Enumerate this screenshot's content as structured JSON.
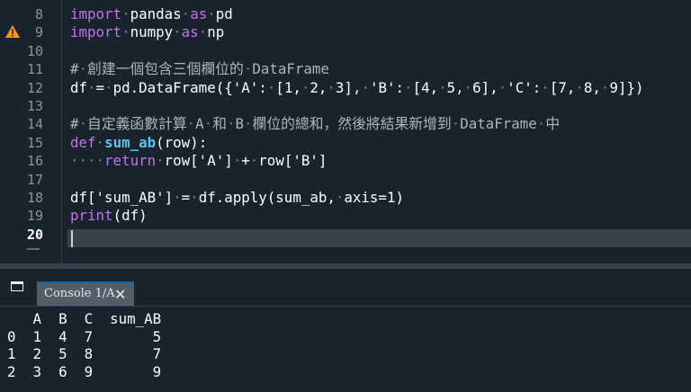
{
  "editor": {
    "line_numbers": [
      "8",
      "9",
      "10",
      "11",
      "12",
      "13",
      "14",
      "15",
      "16",
      "17",
      "18",
      "19",
      "20"
    ],
    "current_line": "20",
    "lines": [
      [
        {
          "c": "kw",
          "t": "import"
        },
        {
          "c": "dt",
          "t": "·"
        },
        {
          "c": "",
          "t": "pandas"
        },
        {
          "c": "dt",
          "t": "·"
        },
        {
          "c": "kw",
          "t": "as"
        },
        {
          "c": "dt",
          "t": "·"
        },
        {
          "c": "",
          "t": "pd"
        }
      ],
      [
        {
          "c": "kw",
          "t": "import"
        },
        {
          "c": "dt",
          "t": "·"
        },
        {
          "c": "",
          "t": "numpy"
        },
        {
          "c": "dt",
          "t": "·"
        },
        {
          "c": "kw",
          "t": "as"
        },
        {
          "c": "dt",
          "t": "·"
        },
        {
          "c": "",
          "t": "np"
        }
      ],
      [],
      [
        {
          "c": "cm",
          "t": "#"
        },
        {
          "c": "dt",
          "t": "·"
        },
        {
          "c": "cm",
          "t": "創建一個包含三個欄位的"
        },
        {
          "c": "dt",
          "t": "·"
        },
        {
          "c": "cm",
          "t": "DataFrame"
        }
      ],
      [
        {
          "c": "",
          "t": "df"
        },
        {
          "c": "dt",
          "t": "·"
        },
        {
          "c": "",
          "t": "="
        },
        {
          "c": "dt",
          "t": "·"
        },
        {
          "c": "",
          "t": "pd.DataFrame({'"
        },
        {
          "c": "st",
          "t": "A"
        },
        {
          "c": "",
          "t": "':"
        },
        {
          "c": "dt",
          "t": "·"
        },
        {
          "c": "",
          "t": "[1,"
        },
        {
          "c": "dt",
          "t": "·"
        },
        {
          "c": "",
          "t": "2,"
        },
        {
          "c": "dt",
          "t": "·"
        },
        {
          "c": "",
          "t": "3],"
        },
        {
          "c": "dt",
          "t": "·"
        },
        {
          "c": "",
          "t": "'"
        },
        {
          "c": "st",
          "t": "B"
        },
        {
          "c": "",
          "t": "':"
        },
        {
          "c": "dt",
          "t": "·"
        },
        {
          "c": "",
          "t": "[4,"
        },
        {
          "c": "dt",
          "t": "·"
        },
        {
          "c": "",
          "t": "5,"
        },
        {
          "c": "dt",
          "t": "·"
        },
        {
          "c": "",
          "t": "6],"
        },
        {
          "c": "dt",
          "t": "·"
        },
        {
          "c": "",
          "t": "'"
        },
        {
          "c": "st",
          "t": "C"
        },
        {
          "c": "",
          "t": "':"
        },
        {
          "c": "dt",
          "t": "·"
        },
        {
          "c": "",
          "t": "[7,"
        },
        {
          "c": "dt",
          "t": "·"
        },
        {
          "c": "",
          "t": "8,"
        },
        {
          "c": "dt",
          "t": "·"
        },
        {
          "c": "",
          "t": "9]})"
        }
      ],
      [],
      [
        {
          "c": "cm",
          "t": "#"
        },
        {
          "c": "dt",
          "t": "·"
        },
        {
          "c": "cm",
          "t": "自定義函數計算"
        },
        {
          "c": "dt",
          "t": "·"
        },
        {
          "c": "cm",
          "t": "A"
        },
        {
          "c": "dt",
          "t": "·"
        },
        {
          "c": "cm",
          "t": "和"
        },
        {
          "c": "dt",
          "t": "·"
        },
        {
          "c": "cm",
          "t": "B"
        },
        {
          "c": "dt",
          "t": "·"
        },
        {
          "c": "cm",
          "t": "欄位的總和，然後將結果新增到"
        },
        {
          "c": "dt",
          "t": "·"
        },
        {
          "c": "cm",
          "t": "DataFrame"
        },
        {
          "c": "dt",
          "t": "·"
        },
        {
          "c": "cm",
          "t": "中"
        }
      ],
      [
        {
          "c": "kw",
          "t": "def"
        },
        {
          "c": "dt",
          "t": "·"
        },
        {
          "c": "fn",
          "t": "sum_ab"
        },
        {
          "c": "",
          "t": "(row):"
        }
      ],
      [
        {
          "c": "dt",
          "t": "····"
        },
        {
          "c": "kw",
          "t": "return"
        },
        {
          "c": "dt",
          "t": "·"
        },
        {
          "c": "",
          "t": "row['"
        },
        {
          "c": "st",
          "t": "A"
        },
        {
          "c": "",
          "t": "']"
        },
        {
          "c": "dt",
          "t": "·"
        },
        {
          "c": "",
          "t": "+"
        },
        {
          "c": "dt",
          "t": "·"
        },
        {
          "c": "",
          "t": "row['"
        },
        {
          "c": "st",
          "t": "B"
        },
        {
          "c": "",
          "t": "']"
        }
      ],
      [],
      [
        {
          "c": "",
          "t": "df['"
        },
        {
          "c": "st",
          "t": "sum_AB"
        },
        {
          "c": "",
          "t": "']"
        },
        {
          "c": "dt",
          "t": "·"
        },
        {
          "c": "",
          "t": "="
        },
        {
          "c": "dt",
          "t": "·"
        },
        {
          "c": "",
          "t": "df.apply(sum_ab,"
        },
        {
          "c": "dt",
          "t": "·"
        },
        {
          "c": "",
          "t": "axis=1)"
        }
      ],
      [
        {
          "c": "kw",
          "t": "print"
        },
        {
          "c": "",
          "t": "(df)"
        }
      ],
      []
    ]
  },
  "console": {
    "tab_label": "Console 1/A",
    "close_symbol": "✕",
    "output_lines": [
      "   A  B  C  sum_AB",
      "0  1  4  7       5",
      "1  2  5  8       7",
      "2  3  6  9       9"
    ]
  },
  "icons": {
    "warning": "warning-icon",
    "pane": "pane-window-icon",
    "close": "close-icon"
  },
  "colors": {
    "background": "#19232d",
    "keyword": "#c770ef",
    "function_name": "#5ec1ef",
    "comment": "#a9b5bf",
    "warning": "#ff9900",
    "tab_bg": "#505f69",
    "tab_accent": "#1464a0"
  }
}
